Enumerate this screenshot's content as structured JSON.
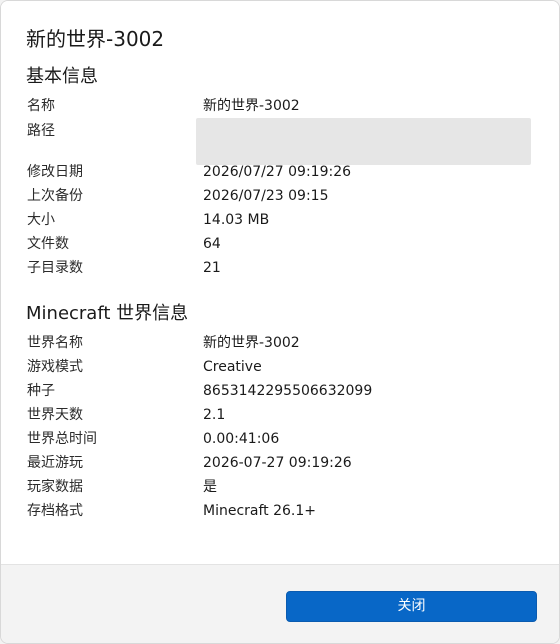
{
  "dialog": {
    "title": "新的世界-3002"
  },
  "basic_info": {
    "heading": "基本信息",
    "name_label": "名称",
    "name_value": "新的世界-3002",
    "path_label": "路径",
    "modified_label": "修改日期",
    "modified_value": "2026/07/27 09:19:26",
    "last_backup_label": "上次备份",
    "last_backup_value": "2026/07/23 09:15",
    "size_label": "大小",
    "size_value": "14.03 MB",
    "file_count_label": "文件数",
    "file_count_value": "64",
    "subdir_count_label": "子目录数",
    "subdir_count_value": "21"
  },
  "world_info": {
    "heading": "Minecraft 世界信息",
    "world_name_label": "世界名称",
    "world_name_value": "新的世界-3002",
    "game_mode_label": "游戏模式",
    "game_mode_value": "Creative",
    "seed_label": "种子",
    "seed_value": "8653142295506632099",
    "world_days_label": "世界天数",
    "world_days_value": "2.1",
    "world_time_label": "世界总时间",
    "world_time_value": "0.00:41:06",
    "last_played_label": "最近游玩",
    "last_played_value": "2026-07-27 09:19:26",
    "player_data_label": "玩家数据",
    "player_data_value": "是",
    "save_format_label": "存档格式",
    "save_format_value": "Minecraft 26.1+"
  },
  "footer": {
    "close_label": "关闭"
  },
  "colors": {
    "accent": "#0867c7",
    "path_placeholder": "#e6e6e6"
  }
}
